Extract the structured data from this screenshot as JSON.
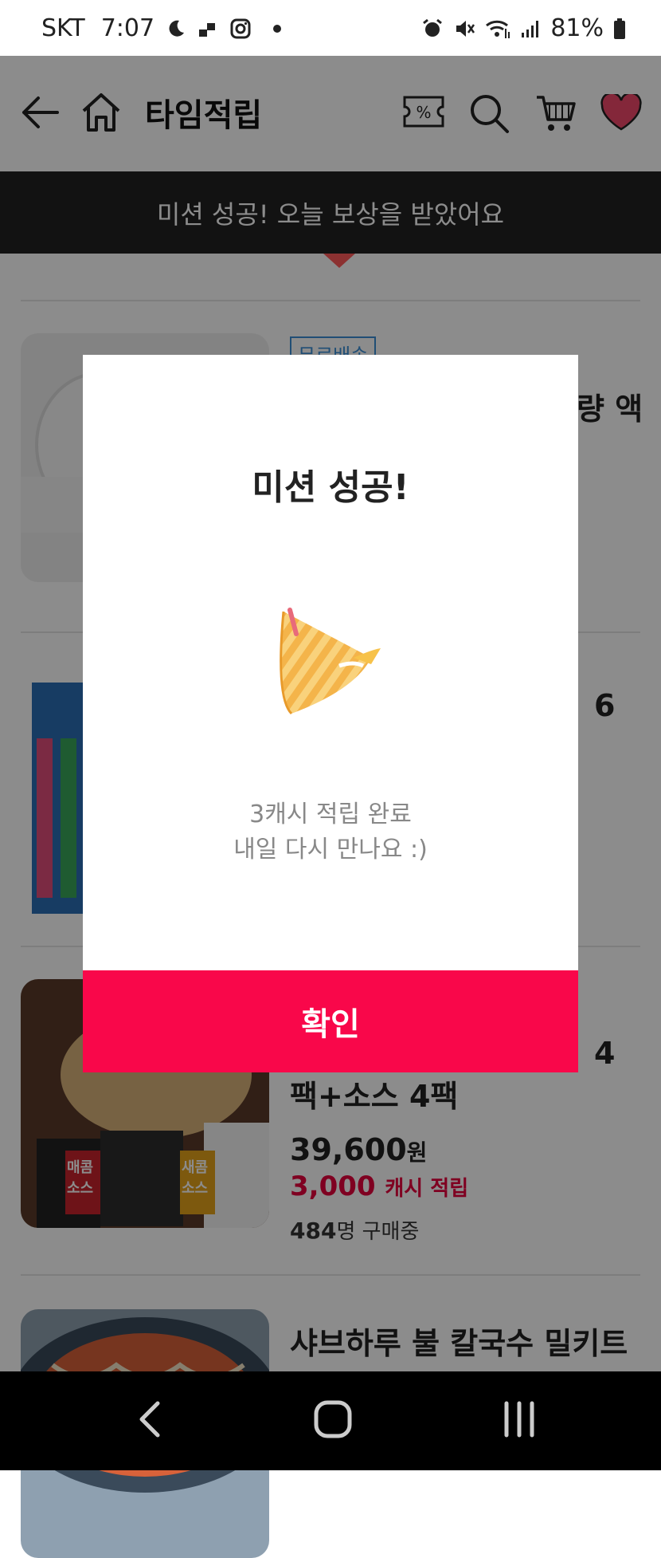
{
  "status_bar": {
    "carrier": "SKT",
    "time": "7:07",
    "battery": "81%",
    "icons": [
      "moon-icon",
      "notification-icon",
      "instagram-icon",
      "dot-icon",
      "alarm-icon",
      "mute-icon",
      "wifi-icon",
      "signal-icon",
      "battery-icon"
    ]
  },
  "header": {
    "title": "타임적립",
    "icons": [
      "back-arrow-icon",
      "home-icon",
      "coupon-icon",
      "search-icon",
      "cart-icon",
      "heart-icon"
    ],
    "heart_color": "#f0486b"
  },
  "banner": {
    "text": "미션 성공! 오늘 보상을 받았어요",
    "bg": "#222222"
  },
  "products": [
    {
      "tag": "무료배송",
      "name_visible": "량 액"
    },
    {
      "name_visible": "6"
    },
    {
      "name_line1_visible": "4",
      "name_line2": "팩+소스 4팩",
      "price": "39,600",
      "price_unit": "원",
      "cash": "3,000",
      "cash_label": "캐시 적립",
      "buyers_count": "484",
      "buyers_label": "명 구매중",
      "thumb_texts": [
        "매콤 소스",
        "새콤 소스"
      ]
    },
    {
      "name": "샤브하루 불 칼국수 밀키트"
    }
  ],
  "modal": {
    "title": "미션 성공!",
    "message_line1": "3캐시 적립 완료",
    "message_line2": "내일 다시 만나요 :)",
    "confirm_label": "확인",
    "confirm_color": "#f9074a"
  },
  "nav_bar": {
    "buttons": [
      "back-nav-icon",
      "home-nav-icon",
      "recents-nav-icon"
    ]
  }
}
